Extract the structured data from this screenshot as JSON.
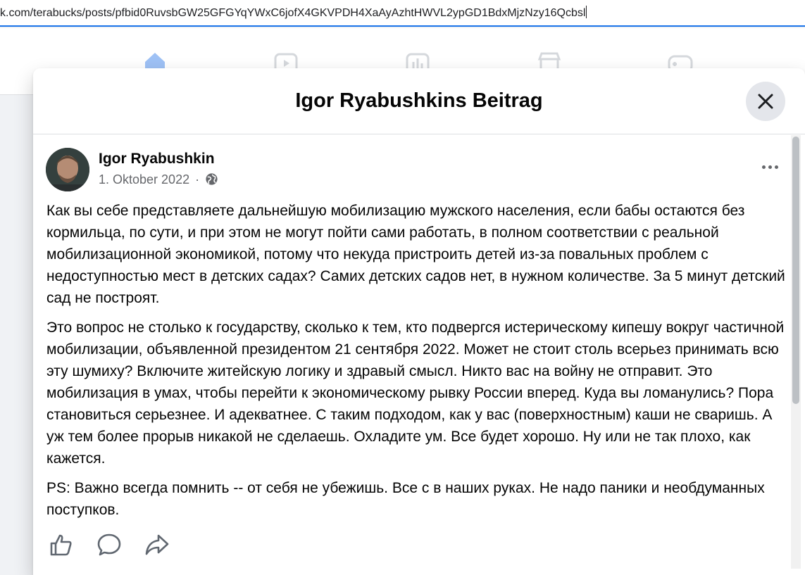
{
  "browser": {
    "url": "k.com/terabucks/posts/pfbid0RuvsbGW25GFGYqYWxC6jofX4GKVPDH4XaAyAzhtHWVL2ypGD1BdxMjzNzy16Qcbsl"
  },
  "nav": {
    "icons": [
      "home-icon",
      "video-icon",
      "chart-icon",
      "marketplace-icon",
      "gaming-icon"
    ],
    "accent_color": "#1877f2"
  },
  "modal": {
    "title": "Igor Ryabushkins Beitrag"
  },
  "post": {
    "author": "Igor Ryabushkin",
    "date": "1. Oktober 2022",
    "separator": "·",
    "paragraphs": [
      "Как вы себе представляете дальнейшую мобилизацию мужского населения, если бабы остаются без кормильца, по сути, и при этом  не могут пойти сами работать, в полном соответствии с реальной мобилизационной экономикой, потому что некуда пристроить детей из-за повальных проблем с недоступностью мест в детских садах? Самих детских садов нет, в нужном количестве. За 5 минут детский сад не построят.",
      "Это вопрос не столько к государству, сколько к тем, кто подвергся истерическому кипешу вокруг частичной мобилизации, объявленной президентом 21 сентября 2022. Может не стоит столь всерьез принимать всю эту шумиху? Включите житейскую логику и здравый смысл. Никто вас на войну не отправит. Это мобилизация в умах, чтобы перейти к экономическому рывку России вперед. Куда вы ломанулись? Пора становиться серьезнее. И адекватнее. С таким подходом, как у вас (поверхностным) каши не сваришь. А уж тем более прорыв никакой не сделаешь. Охладите ум. Все будет хорошо. Ну или не так плохо, как кажется.",
      "PS: Важно всегда помнить -- от себя не убежишь. Все с в наших руках. Не надо паники и необдуманных поступков."
    ],
    "actions": [
      "like-icon",
      "comment-icon",
      "share-icon"
    ]
  }
}
